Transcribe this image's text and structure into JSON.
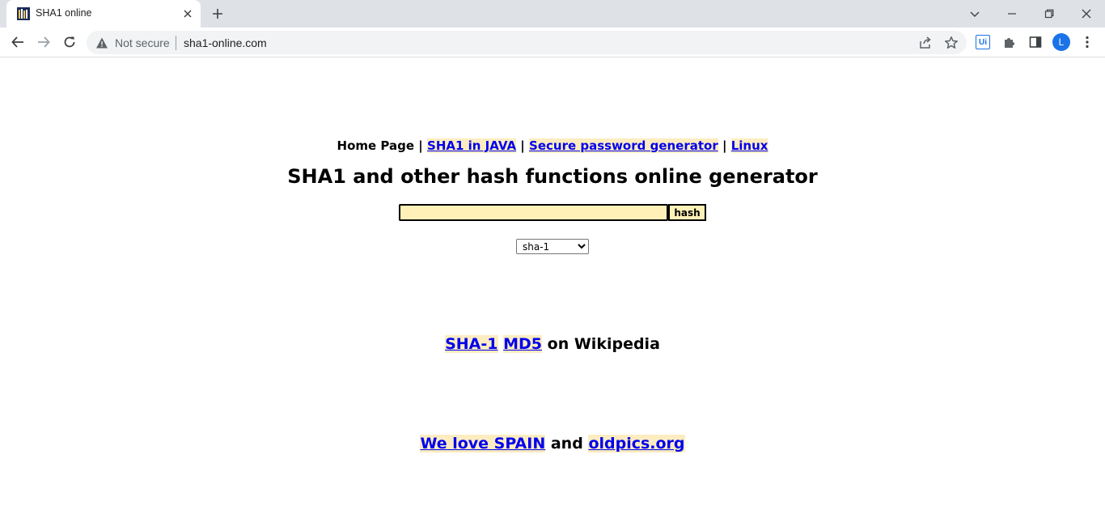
{
  "browser": {
    "tab_title": "SHA1 online",
    "security_label": "Not secure",
    "url": "sha1-online.com",
    "profile_initial": "L",
    "extension_label": "Ui"
  },
  "nav": {
    "home": "Home Page",
    "sep": "|",
    "links": [
      "SHA1 in JAVA",
      "Secure password generator",
      "Linux"
    ]
  },
  "main": {
    "title": "SHA1 and other hash functions online generator",
    "input_value": "",
    "hash_button": "hash",
    "algorithm_selected": "sha-1"
  },
  "wiki": {
    "links": [
      "SHA-1",
      "MD5"
    ],
    "suffix": "on Wikipedia"
  },
  "promo": {
    "link1": "We love SPAIN",
    "connector": "and",
    "link2": "oldpics.org"
  },
  "colors": {
    "highlight": "#fcecc0",
    "input_bg": "#fff0b8",
    "link": "#0000ee"
  }
}
